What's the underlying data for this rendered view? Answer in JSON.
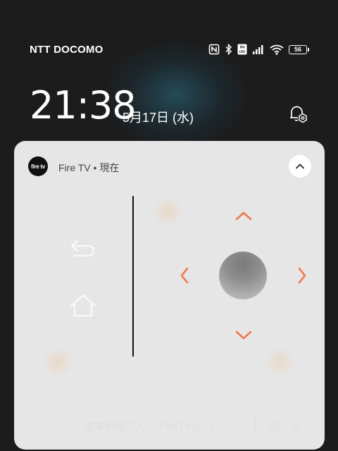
{
  "status_bar": {
    "carrier": "NTT DOCOMO",
    "battery_level": "56",
    "icons": [
      "nfc-icon",
      "bluetooth-icon",
      "volte-icon",
      "cell-signal-icon",
      "wifi-icon",
      "battery-icon"
    ]
  },
  "lockscreen": {
    "time": "21:38",
    "date": "5月17日 (水)"
  },
  "notification": {
    "app_icon_text": "fire tv",
    "app_title": "Fire TV • 現在",
    "remote_icons": [
      "back-icon",
      "home-icon",
      "dpad-up-icon",
      "dpad-left-icon",
      "dpad-right-icon",
      "dpad-down-icon",
      "ok-button"
    ],
    "accent_color": "#f0784a",
    "bottom_text": "橋本美穂さんの FireTVSt...!",
    "bottom_close": "閉じる"
  }
}
